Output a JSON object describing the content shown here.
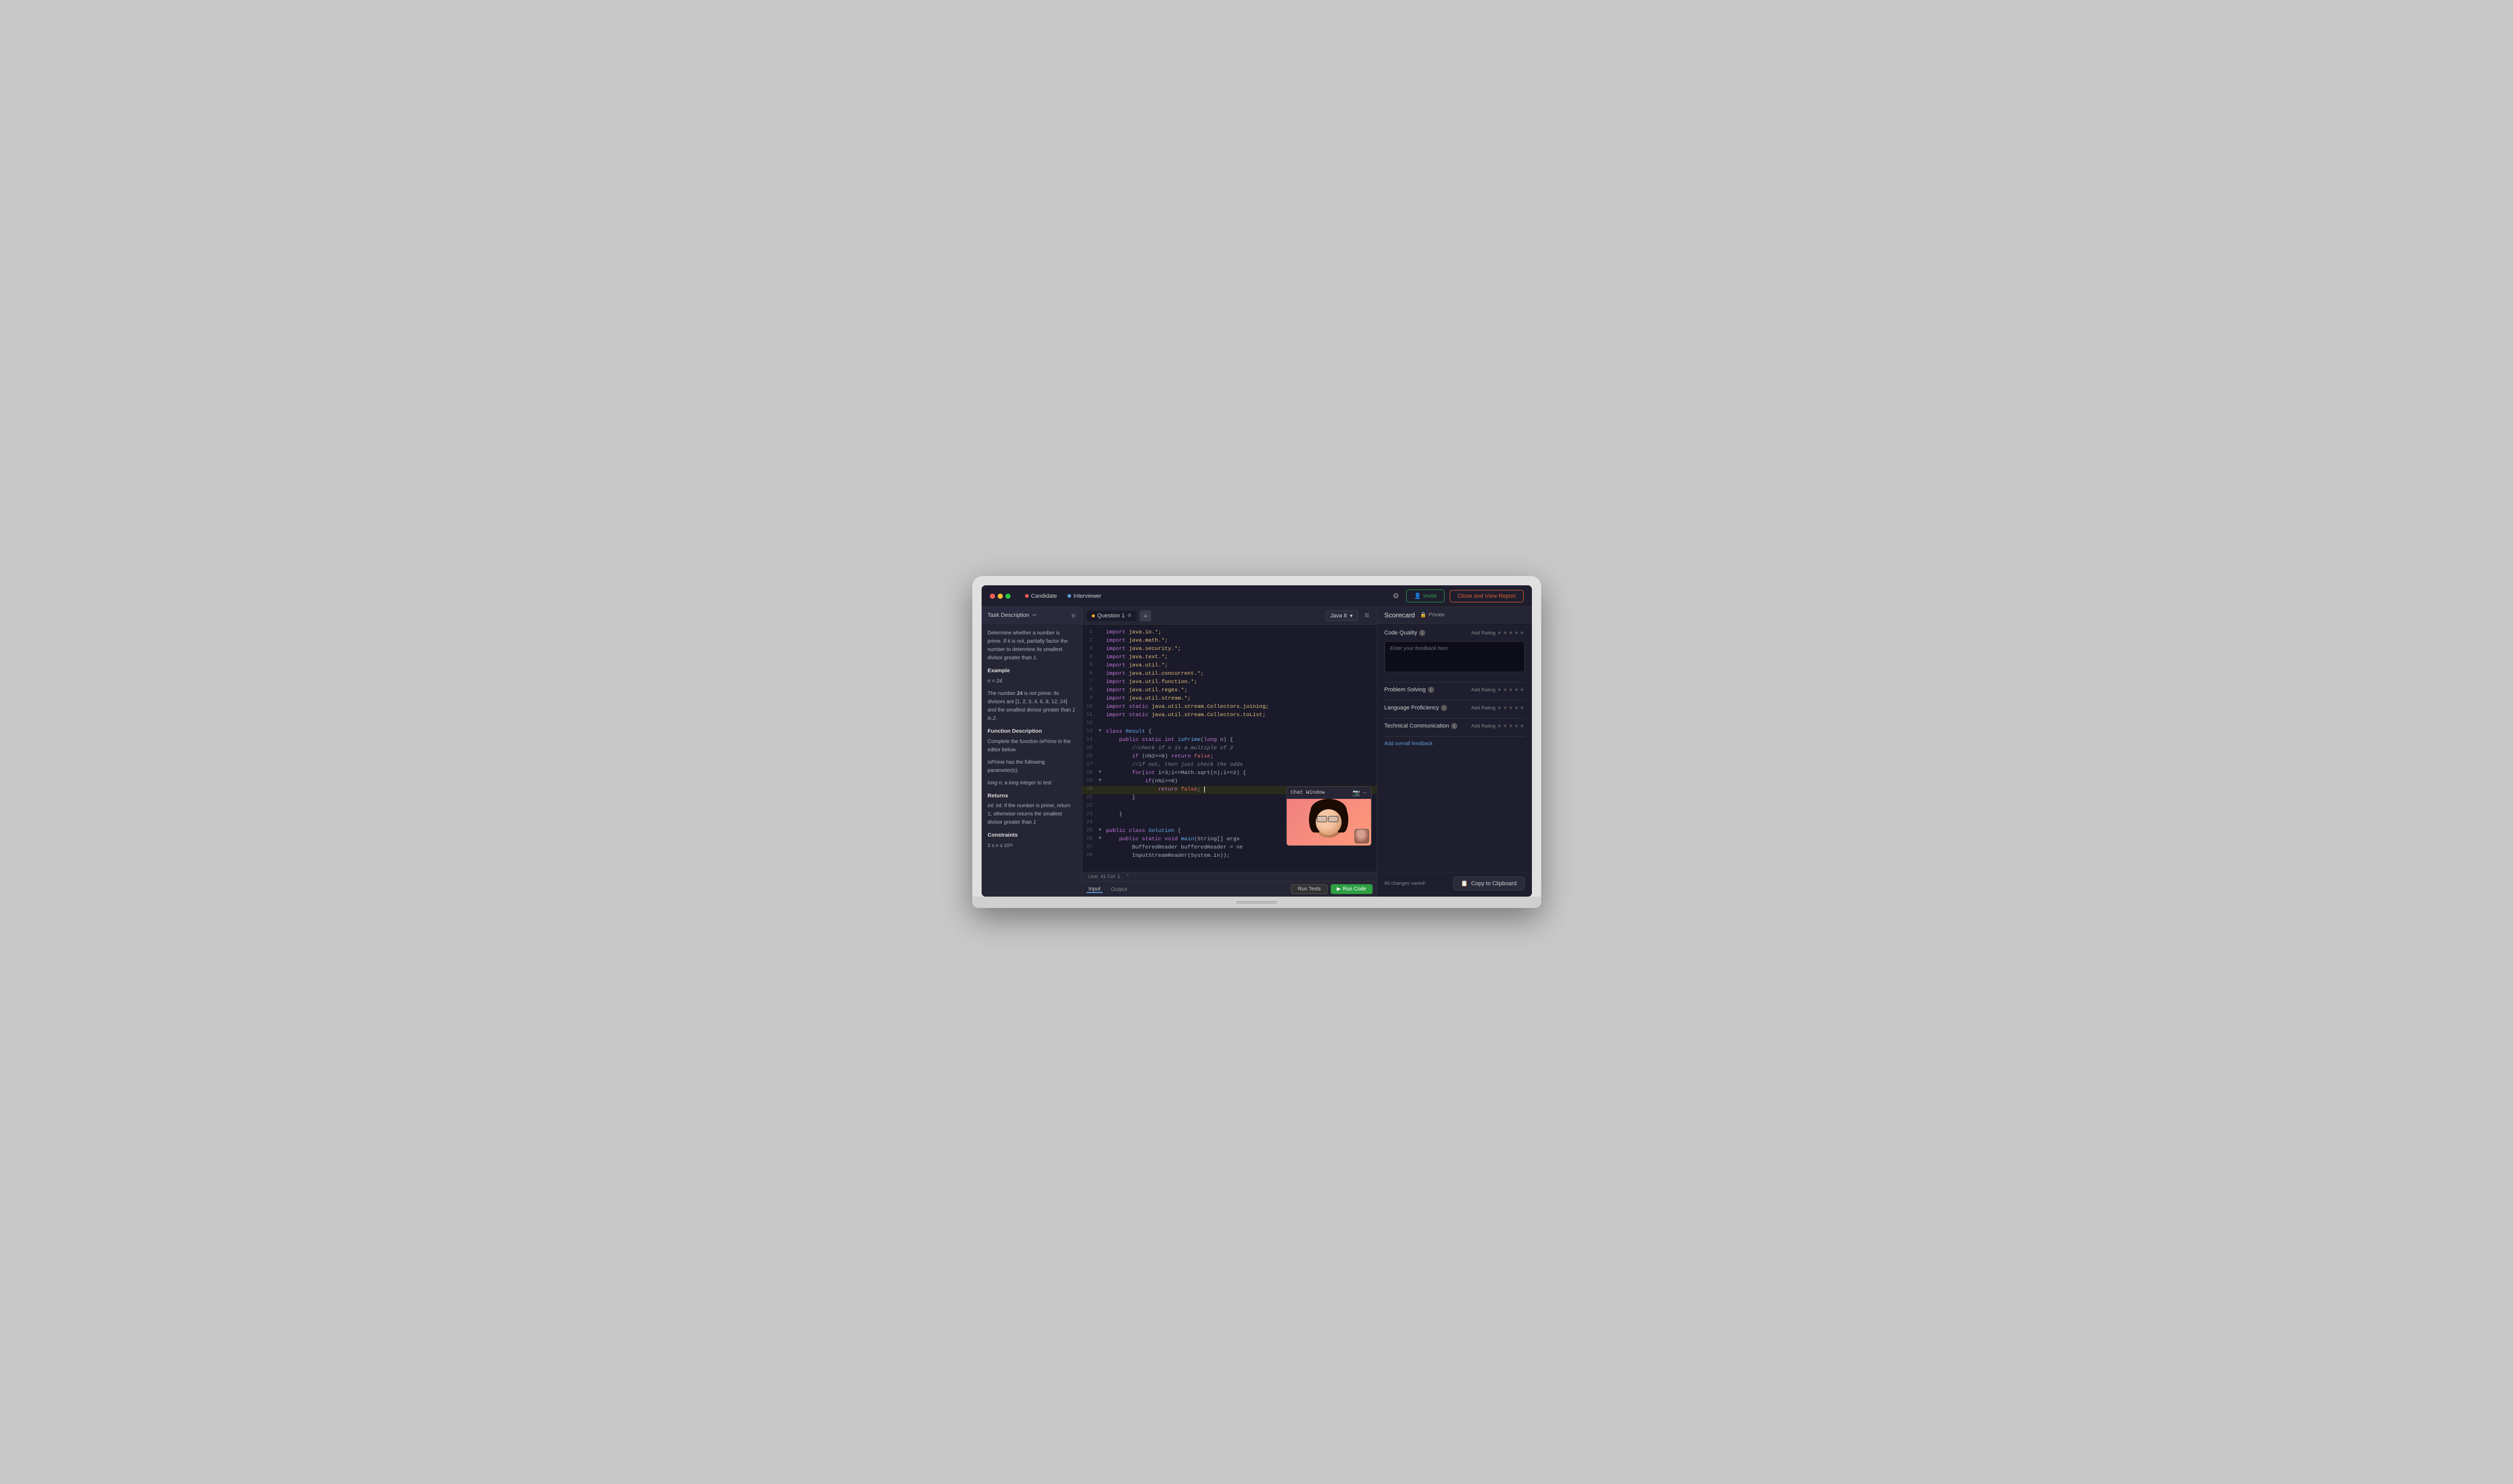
{
  "topbar": {
    "candidate_label": "Candidate",
    "interviewer_label": "Interviewer",
    "invite_label": "Invite",
    "close_view_label": "Close and View Report"
  },
  "task": {
    "header_label": "Task Description",
    "description_1": "Determine whether a number is prime. If it is not, partially factor the number to determine its smallest divisor greater than",
    "description_1_italic": "1",
    "example_title": "Example",
    "example_n": "n = 24",
    "description_2": "The number",
    "description_2_bold": "24",
    "description_2_cont": "is not prime: its divisors are [1, 2, 3, 4, 6, 8, 12, 24] and the smallest divisor greater than",
    "description_2_italic": "1",
    "description_2_end": "is",
    "description_2_num": "2",
    "function_title": "Function Description",
    "function_text": "Complete the function",
    "function_name": "isPrime",
    "function_text2": "in the editor below.",
    "params_text": "isPrime has the following parameter(s):",
    "param_1": "long n: a long integer to test",
    "returns_title": "Returns",
    "returns_text": "int: if the number is prime, return 1; otherwise returns the smallest divisor greater than",
    "returns_italic": "1",
    "constraints_title": "Constraints",
    "constraints_text": "2 ≤ n ≤ 10¹²"
  },
  "editor": {
    "tab_label": "Question 1",
    "language": "Java 8",
    "status_bar": "Line: 41  Col: 1",
    "code_lines": [
      {
        "num": 1,
        "content": "import java.io.*;"
      },
      {
        "num": 2,
        "content": "import java.math.*;"
      },
      {
        "num": 3,
        "content": "import java.security.*;"
      },
      {
        "num": 4,
        "content": "import java.text.*;"
      },
      {
        "num": 5,
        "content": "import java.util.*;"
      },
      {
        "num": 6,
        "content": "import java.util.concurrent.*;"
      },
      {
        "num": 7,
        "content": "import java.util.function.*;"
      },
      {
        "num": 8,
        "content": "import java.util.regex.*;"
      },
      {
        "num": 9,
        "content": "import java.util.stream.*;"
      },
      {
        "num": 10,
        "content": "import static java.util.stream.Collectors.joining;"
      },
      {
        "num": 11,
        "content": "import static java.util.stream.Collectors.toList;"
      },
      {
        "num": 12,
        "content": ""
      },
      {
        "num": 13,
        "content": "class Result {",
        "arrow": true
      },
      {
        "num": 14,
        "content": "    public static int isPrime(long n) {"
      },
      {
        "num": 15,
        "content": "        //check if n is a multiple of 2"
      },
      {
        "num": 16,
        "content": "        if (n%2==0) return false;"
      },
      {
        "num": 17,
        "content": "        //if not, then just check the odds"
      },
      {
        "num": 18,
        "content": "        for(int i=3;i<=Math.sqrt(n);i+=2) {",
        "arrow": true
      },
      {
        "num": 19,
        "content": "            if(n%i==0)",
        "arrow": true
      },
      {
        "num": 20,
        "content": "                return false; |"
      },
      {
        "num": 21,
        "content": "        }"
      },
      {
        "num": 22,
        "content": ""
      },
      {
        "num": 23,
        "content": "    }"
      },
      {
        "num": 24,
        "content": ""
      },
      {
        "num": 25,
        "content": "public class Solution {",
        "arrow": true
      },
      {
        "num": 26,
        "content": "    public static void main(String[] args",
        "arrow": true
      },
      {
        "num": 27,
        "content": "        BufferedReader bufferedReader = ne"
      },
      {
        "num": 28,
        "content": "        InputStreamReader(System.in));"
      }
    ],
    "input_tab": "Input",
    "output_tab": "Output",
    "run_tests_label": "Run Tests",
    "run_code_label": "Run Code"
  },
  "scorecard": {
    "title": "Scorecard",
    "private_label": "Private",
    "code_quality_label": "Code Quality",
    "problem_solving_label": "Problem Solving",
    "language_proficiency_label": "Language Proficiency",
    "technical_communication_label": "Technical Communication",
    "add_rating_label": "Add Rating",
    "feedback_placeholder": "Enter your feedback here",
    "add_overall_label": "Add overall feedback",
    "saved_status": "All changes saved!",
    "copy_clipboard_label": "Copy to Clipboard"
  },
  "chat_window": {
    "title": "Chat Window"
  }
}
